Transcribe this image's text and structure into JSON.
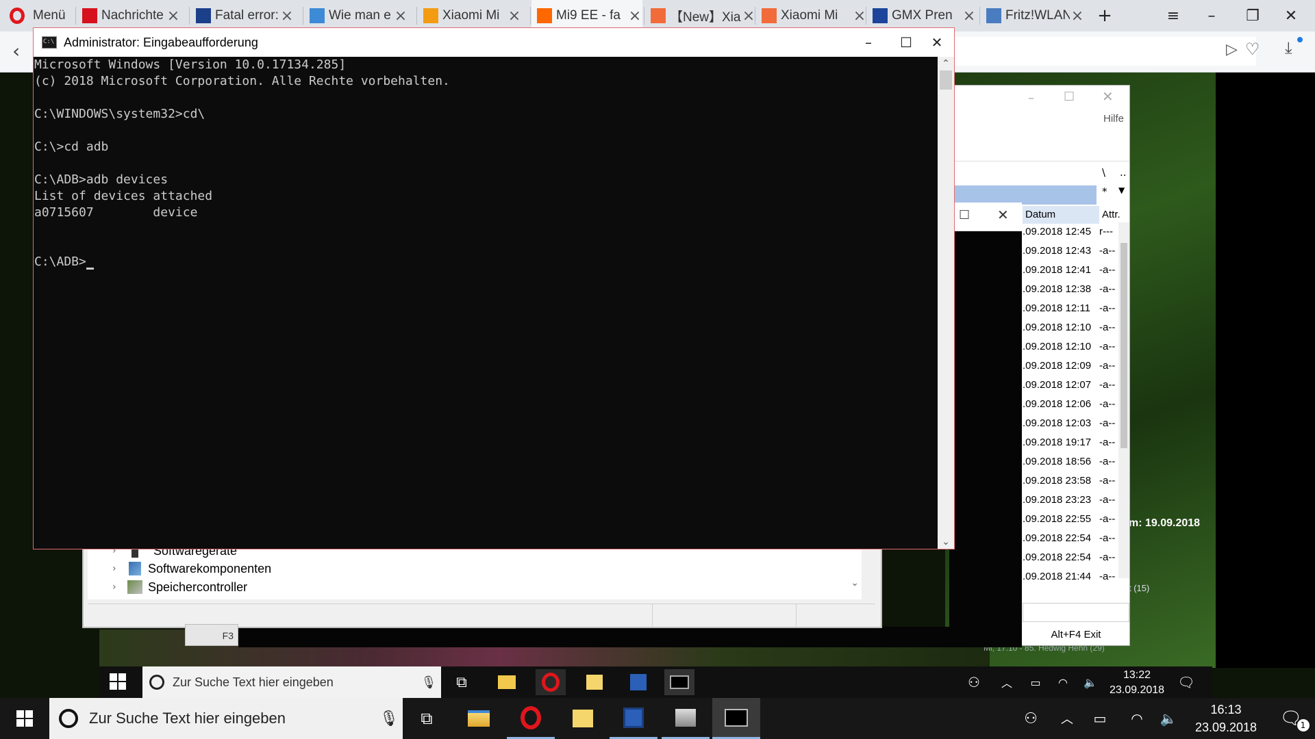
{
  "browser": {
    "menu_label": "Menü",
    "tabs": [
      {
        "title": "Nachrichte",
        "favicon": "ntv",
        "color": "#d7101e"
      },
      {
        "title": "Fatal error:",
        "favicon": "FLI",
        "color": "#1c3f8a"
      },
      {
        "title": "Wie man e",
        "favicon": "sky-icon",
        "color": "#3d8ad6"
      },
      {
        "title": "Xiaomi Mi",
        "favicon": "xda",
        "color": "#f39c12"
      },
      {
        "title": "Mi9 EE - fa",
        "favicon": "mi",
        "color": "#ff6700"
      },
      {
        "title": "【New】Xia",
        "favicon": "MIUI",
        "color": "#f26b3a"
      },
      {
        "title": "Xiaomi Mi",
        "favicon": "MIUI",
        "color": "#f26b3a"
      },
      {
        "title": "GMX Pren",
        "favicon": "GMX",
        "color": "#1c449b"
      },
      {
        "title": "Fritz!WLAN",
        "favicon": "PF",
        "color": "#4a7cc0"
      }
    ]
  },
  "cmd": {
    "title": "Administrator: Eingabeaufforderung",
    "lines": [
      "Microsoft Windows [Version 10.0.17134.285]",
      "(c) 2018 Microsoft Corporation. Alle Rechte vorbehalten.",
      "",
      "C:\\WINDOWS\\system32>cd\\",
      "",
      "C:\\>cd adb",
      "",
      "C:\\ADB>adb devices",
      "List of devices attached",
      "a0715607        device",
      "",
      ""
    ],
    "prompt": "C:\\ADB>"
  },
  "device_manager": {
    "items": [
      "Softwaregeräte",
      "Softwarekomponenten",
      "Speichercontroller"
    ]
  },
  "file_manager": {
    "menu_help": "Hilfe",
    "col_date": "Datum",
    "col_attr": "Attr.",
    "col_backslash": "\\",
    "col_dots": "..",
    "col_star": "*",
    "rows": [
      {
        "date": ".09.2018 12:45",
        "attr": "r---"
      },
      {
        "date": ".09.2018 12:43",
        "attr": "-a--"
      },
      {
        "date": ".09.2018 12:41",
        "attr": "-a--"
      },
      {
        "date": ".09.2018 12:38",
        "attr": "-a--"
      },
      {
        "date": ".09.2018 12:11",
        "attr": "-a--"
      },
      {
        "date": ".09.2018 12:10",
        "attr": "-a--"
      },
      {
        "date": ".09.2018 12:10",
        "attr": "-a--"
      },
      {
        "date": ".09.2018 12:09",
        "attr": "-a--"
      },
      {
        "date": ".09.2018 12:07",
        "attr": "-a--"
      },
      {
        "date": ".09.2018 12:06",
        "attr": "-a--"
      },
      {
        "date": ".09.2018 12:03",
        "attr": "-a--"
      },
      {
        "date": ".09.2018 19:17",
        "attr": "-a--"
      },
      {
        "date": ".09.2018 18:56",
        "attr": "-a--"
      },
      {
        "date": ".09.2018 23:58",
        "attr": "-a--"
      },
      {
        "date": ".09.2018 23:23",
        "attr": "-a--"
      },
      {
        "date": ".09.2018 22:55",
        "attr": "-a--"
      },
      {
        "date": ".09.2018 22:54",
        "attr": "-a--"
      },
      {
        "date": ".09.2018 22:54",
        "attr": "-a--"
      },
      {
        "date": ".09.2018 21:44",
        "attr": "-a--"
      }
    ],
    "altf4": "Alt+F4 Exit",
    "f3": "F3"
  },
  "desktop": {
    "date_heading": "m: 19.09.2018",
    "count": "t (15)",
    "birthday": "Mi, 17.10 - 85. Hedwig Hehn (29)"
  },
  "inner_taskbar": {
    "search_placeholder": "Zur Suche Text hier eingeben",
    "time": "13:22",
    "date": "23.09.2018"
  },
  "taskbar": {
    "search_placeholder": "Zur Suche Text hier eingeben",
    "time": "16:13",
    "date": "23.09.2018",
    "notification_count": "1"
  }
}
